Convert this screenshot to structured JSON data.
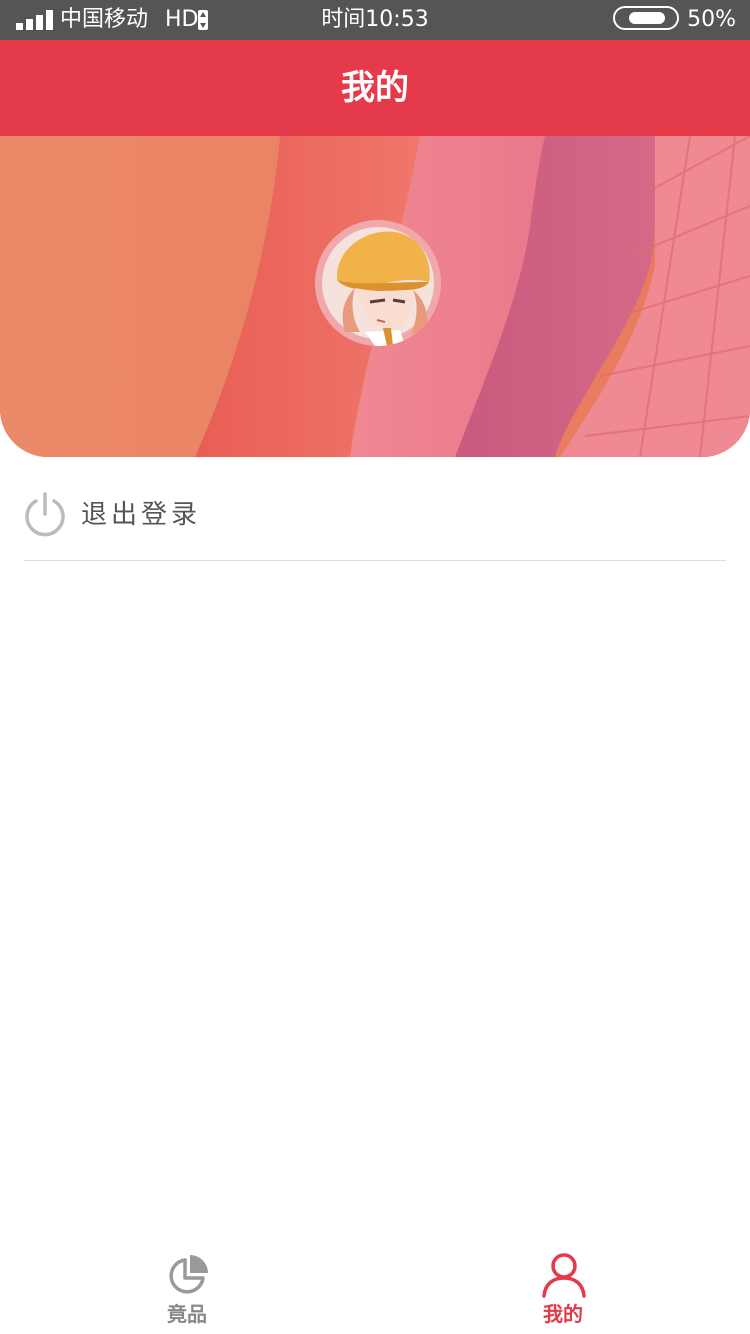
{
  "status_bar": {
    "carrier": "中国移动",
    "network": "HD",
    "time": "时间10:53",
    "battery": "50%",
    "battery_level": 0.5
  },
  "header": {
    "title": "我的"
  },
  "profile": {
    "avatar_icon": "avatar-illustration"
  },
  "menu": {
    "logout_label": "退出登录",
    "logout_icon": "power-icon"
  },
  "tabs": [
    {
      "label": "竟品",
      "icon": "pie-chart-icon",
      "active": false
    },
    {
      "label": "我的",
      "icon": "user-icon",
      "active": true
    }
  ],
  "colors": {
    "accent": "#e53a4a",
    "status_bar": "#555555",
    "inactive": "#888888",
    "text": "#555555"
  }
}
